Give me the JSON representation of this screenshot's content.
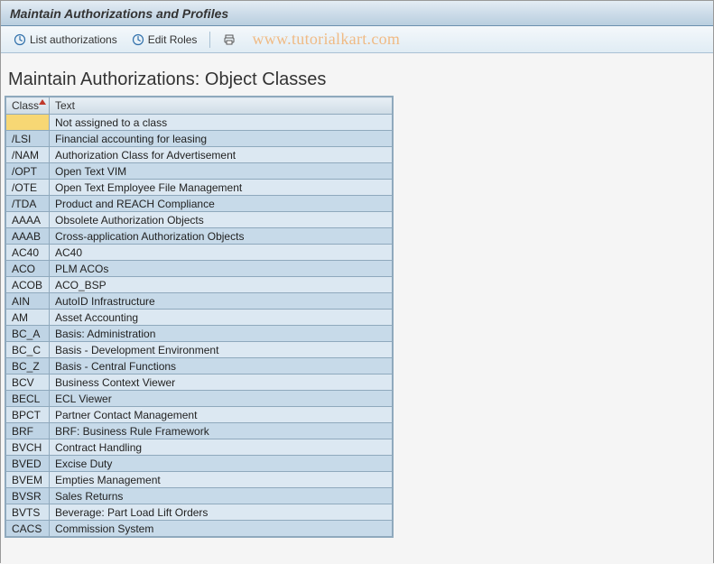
{
  "titlebar": {
    "title": "Maintain Authorizations and Profiles"
  },
  "toolbar": {
    "list_auth_label": "List authorizations",
    "edit_roles_label": "Edit Roles"
  },
  "watermark": "www.tutorialkart.com",
  "page": {
    "heading": "Maintain Authorizations: Object Classes"
  },
  "table": {
    "headers": {
      "class": "Class",
      "text": "Text"
    },
    "rows": [
      {
        "class": "",
        "text": "Not assigned to a class",
        "selected": true
      },
      {
        "class": "/LSI",
        "text": "Financial accounting for leasing"
      },
      {
        "class": "/NAM",
        "text": "Authorization Class for Advertisement"
      },
      {
        "class": "/OPT",
        "text": "Open Text VIM"
      },
      {
        "class": "/OTE",
        "text": "Open Text Employee File Management"
      },
      {
        "class": "/TDA",
        "text": "Product and REACH Compliance"
      },
      {
        "class": "AAAA",
        "text": "Obsolete Authorization Objects"
      },
      {
        "class": "AAAB",
        "text": "Cross-application Authorization Objects"
      },
      {
        "class": "AC40",
        "text": "AC40"
      },
      {
        "class": "ACO",
        "text": "PLM ACOs"
      },
      {
        "class": "ACOB",
        "text": "ACO_BSP"
      },
      {
        "class": "AIN",
        "text": "AutoID Infrastructure"
      },
      {
        "class": "AM",
        "text": "Asset Accounting"
      },
      {
        "class": "BC_A",
        "text": "Basis: Administration"
      },
      {
        "class": "BC_C",
        "text": "Basis - Development Environment"
      },
      {
        "class": "BC_Z",
        "text": "Basis - Central Functions"
      },
      {
        "class": "BCV",
        "text": "Business Context Viewer"
      },
      {
        "class": "BECL",
        "text": "ECL Viewer"
      },
      {
        "class": "BPCT",
        "text": "Partner Contact Management"
      },
      {
        "class": "BRF",
        "text": "BRF: Business Rule Framework"
      },
      {
        "class": "BVCH",
        "text": "Contract Handling"
      },
      {
        "class": "BVED",
        "text": "Excise Duty"
      },
      {
        "class": "BVEM",
        "text": "Empties Management"
      },
      {
        "class": "BVSR",
        "text": "Sales Returns"
      },
      {
        "class": "BVTS",
        "text": "Beverage: Part Load Lift Orders"
      },
      {
        "class": "CACS",
        "text": "Commission System"
      }
    ]
  }
}
